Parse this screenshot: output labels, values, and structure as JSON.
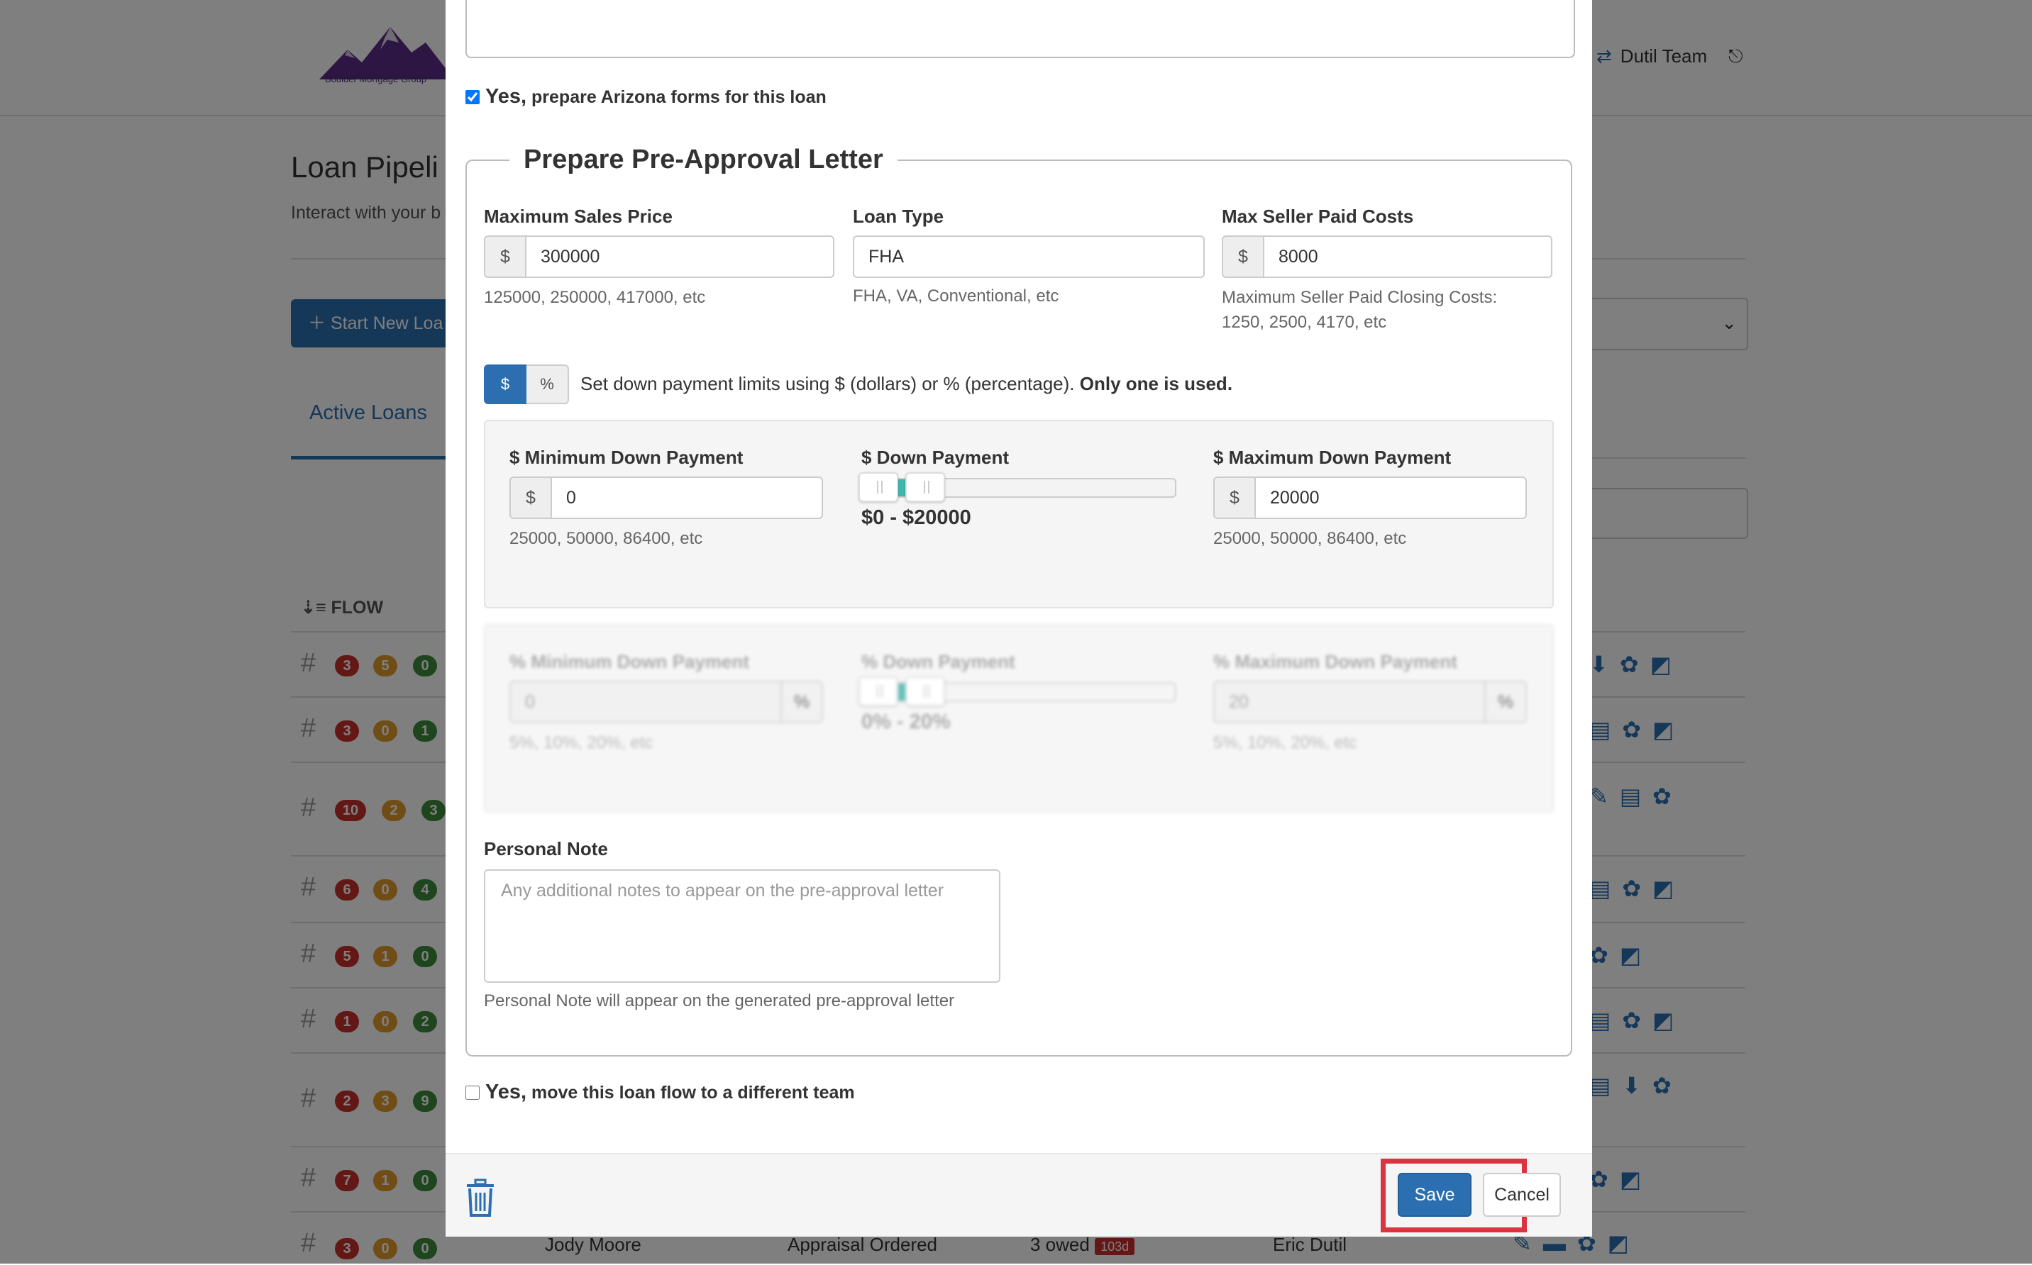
{
  "background": {
    "logo_text": "Boulder Mortgage Group",
    "team_name": "Dutil Team",
    "page_title": "Loan Pipeli",
    "page_subtitle": "Interact with your b",
    "start_button": "Start New Loa",
    "active_tab": "Active Loans",
    "flow_header": "FLOW",
    "rows": [
      {
        "badges": [
          "3",
          "5",
          "0"
        ]
      },
      {
        "badges": [
          "3",
          "0",
          "1"
        ]
      },
      {
        "badges": [
          "10",
          "2",
          "3"
        ]
      },
      {
        "badges": [
          "6",
          "0",
          "4"
        ]
      },
      {
        "badges": [
          "5",
          "1",
          "0"
        ]
      },
      {
        "badges": [
          "1",
          "0",
          "2"
        ]
      },
      {
        "badges": [
          "2",
          "3",
          "9"
        ]
      },
      {
        "badges": [
          "7",
          "1",
          "0"
        ]
      },
      {
        "badges": [
          "3",
          "0",
          "0"
        ],
        "borrower": "Jody Moore",
        "status": "Appraisal Ordered",
        "owed": "3 owed",
        "owed_days": "103d",
        "officer": "Eric Dutil"
      }
    ]
  },
  "modal": {
    "arizona_checkbox": {
      "checked": true,
      "yes": "Yes,",
      "text": "prepare Arizona forms for this loan"
    },
    "preapproval": {
      "legend": "Prepare Pre-Approval Letter",
      "max_sales_price": {
        "label": "Maximum Sales Price",
        "addon": "$",
        "value": "300000",
        "help": "125000, 250000, 417000, etc"
      },
      "loan_type": {
        "label": "Loan Type",
        "value": "FHA",
        "help": "FHA, VA, Conventional, etc"
      },
      "max_seller_paid": {
        "label": "Max Seller Paid Costs",
        "addon": "$",
        "value": "8000",
        "help_line1": "Maximum Seller Paid Closing Costs:",
        "help_line2": "1250, 2500, 4170, etc"
      },
      "toggle": {
        "dollar": "$",
        "percent": "%",
        "text": "Set down payment limits using $ (dollars) or % (percentage).",
        "bold": "Only one is used.",
        "selected": "$"
      },
      "dollar_section": {
        "min_label": "$ Minimum Down Payment",
        "min_addon": "$",
        "min_value": "0",
        "min_help": "25000, 50000, 86400, etc",
        "slider_label": "$ Down Payment",
        "slider_value": "$0 - $20000",
        "max_label": "$ Maximum Down Payment",
        "max_addon": "$",
        "max_value": "20000",
        "max_help": "25000, 50000, 86400, etc"
      },
      "percent_section": {
        "min_label": "% Minimum Down Payment",
        "min_addon": "%",
        "min_value": "0",
        "min_help": "5%, 10%, 20%, etc",
        "slider_label": "% Down Payment",
        "slider_value": "0% - 20%",
        "max_label": "% Maximum Down Payment",
        "max_addon": "%",
        "max_value": "20",
        "max_help": "5%, 10%, 20%, etc"
      },
      "personal_note": {
        "label": "Personal Note",
        "placeholder": "Any additional notes to appear on the pre-approval letter",
        "help": "Personal Note will appear on the generated pre-approval letter"
      }
    },
    "move_team_checkbox": {
      "checked": false,
      "yes": "Yes,",
      "text": "move this loan flow to a different team"
    },
    "footer": {
      "save": "Save",
      "cancel": "Cancel"
    }
  },
  "colors": {
    "primary": "#2b6fb0",
    "highlight": "#d9343f",
    "slider": "#3fb7ad"
  }
}
